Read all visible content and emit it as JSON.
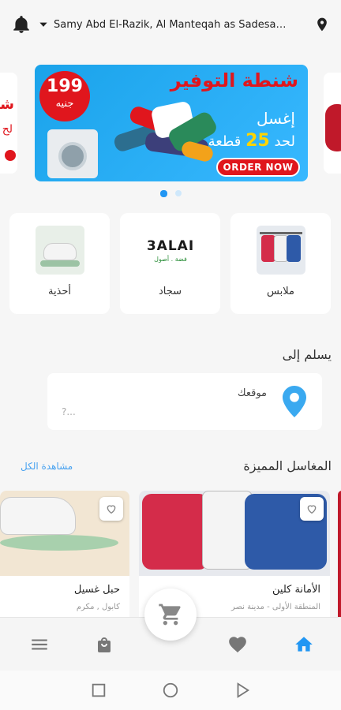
{
  "header": {
    "address": "Samy Abd El-Razik, Al Manteqah as Sadesah, ...",
    "icons": [
      "bell-icon",
      "caret-down-icon",
      "location-pin-icon"
    ]
  },
  "banner": {
    "price": "199",
    "currency": "جنيه",
    "title": "شنطة التوفير",
    "line1": "إغسل",
    "line2_prefix": "لحد",
    "line2_count": "25",
    "line2_suffix": "قطعة",
    "cta": "ORDER NOW",
    "page_count": 2,
    "active_page": 1,
    "accent": "#e0161d",
    "background": "#29aef7"
  },
  "categories": [
    {
      "label": "ملابس",
      "icon": "clothes-image"
    },
    {
      "label": "سجاد",
      "icon": "carpet-brand-image",
      "brand": "3ALAI",
      "brand_sub": "فضة . أصول"
    },
    {
      "label": "أحذية",
      "icon": "shoes-image"
    }
  ],
  "delivery": {
    "title": "يسلم إلى",
    "location_label": "موقعك",
    "location_value": "?..."
  },
  "featured": {
    "title": "المغاسل المميزة",
    "see_all": "مشاهدة الكل",
    "stores": [
      {
        "name": "الأمانة كلين",
        "area": "المنطقة الأولى - مدينة نصر"
      },
      {
        "name": "حبل غسيل",
        "area": "كابول , مكرم"
      }
    ]
  },
  "bottom_nav": {
    "items": [
      "menu-icon",
      "bag-icon",
      "heart-icon",
      "home-icon"
    ],
    "active": "home-icon",
    "cart": "cart-icon",
    "active_color": "#2196f3"
  }
}
